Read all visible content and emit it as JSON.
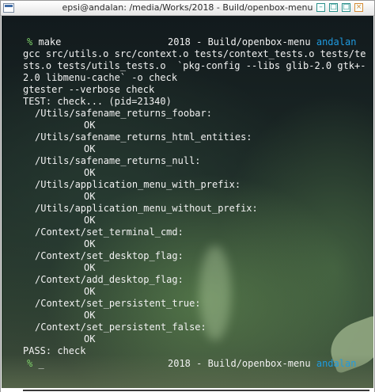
{
  "window": {
    "title": "epsi@andalan: /media/Works/2018 - Build/openbox-menu",
    "icon": "terminal-app-icon",
    "buttons": {
      "minimize": "–",
      "restore": "□",
      "maximize": "□",
      "close": "×"
    },
    "accent_colors": {
      "prompt": "#7fd36a",
      "hostname": "#1f9be0",
      "text": "#f2f2f2"
    }
  },
  "terminal": {
    "prompt_symbol": "%",
    "command": "make",
    "right_prompt_path": "2018 - Build/openbox-menu",
    "right_prompt_host": "andalan",
    "output": [
      "gcc src/utils.o src/context.o tests/context_tests.o tests/te",
      "sts.o tests/utils_tests.o  `pkg-config --libs glib-2.0 gtk+-",
      "2.0 libmenu-cache` -o check",
      "gtester --verbose check",
      "TEST: check... (pid=21340)"
    ],
    "tests": [
      {
        "name": "/Utils/safename_returns_foobar:",
        "result": "OK"
      },
      {
        "name": "/Utils/safename_returns_html_entities:",
        "result": "OK"
      },
      {
        "name": "/Utils/safename_returns_null:",
        "result": "OK"
      },
      {
        "name": "/Utils/application_menu_with_prefix:",
        "result": "OK"
      },
      {
        "name": "/Utils/application_menu_without_prefix:",
        "result": "OK"
      },
      {
        "name": "/Context/set_terminal_cmd:",
        "result": "OK"
      },
      {
        "name": "/Context/set_desktop_flag:",
        "result": "OK"
      },
      {
        "name": "/Context/add_desktop_flag:",
        "result": "OK"
      },
      {
        "name": "/Context/set_persistent_true:",
        "result": "OK"
      },
      {
        "name": "/Context/set_persistent_false:",
        "result": "OK"
      }
    ],
    "summary": "PASS: check",
    "final_prompt_cursor": "_"
  }
}
